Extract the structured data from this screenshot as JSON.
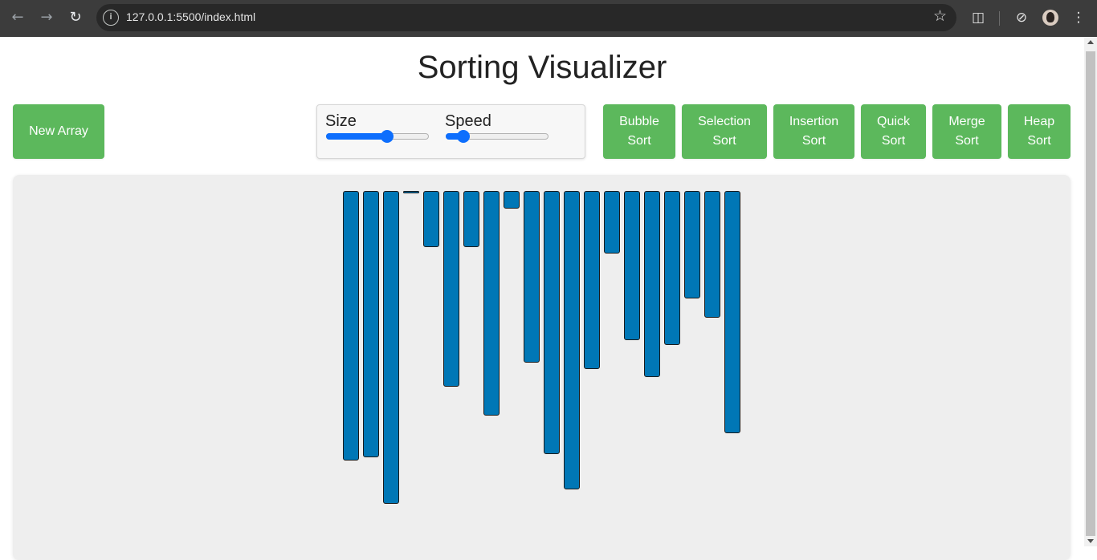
{
  "browser": {
    "url": "127.0.0.1:5500/index.html"
  },
  "page": {
    "title": "Sorting Visualizer",
    "new_array_label": "New Array",
    "size_label": "Size",
    "speed_label": "Speed",
    "size_value": 0.59,
    "speed_value": 0.17,
    "sort_buttons": [
      {
        "line1": "Bubble",
        "line2": "Sort"
      },
      {
        "line1": "Selection",
        "line2": "Sort"
      },
      {
        "line1": "Insertion",
        "line2": "Sort"
      },
      {
        "line1": "Quick",
        "line2": "Sort"
      },
      {
        "line1": "Merge",
        "line2": "Sort"
      },
      {
        "line1": "Heap",
        "line2": "Sort"
      }
    ]
  },
  "colors": {
    "button": "#5cb85c",
    "bar": "#0077b6",
    "slider": "#0d6efd"
  },
  "chart_data": {
    "type": "bar",
    "values": [
      336,
      332,
      390,
      2,
      70,
      244,
      70,
      280,
      22,
      214,
      328,
      372,
      222,
      78,
      186,
      232,
      192,
      134,
      158,
      302
    ]
  }
}
